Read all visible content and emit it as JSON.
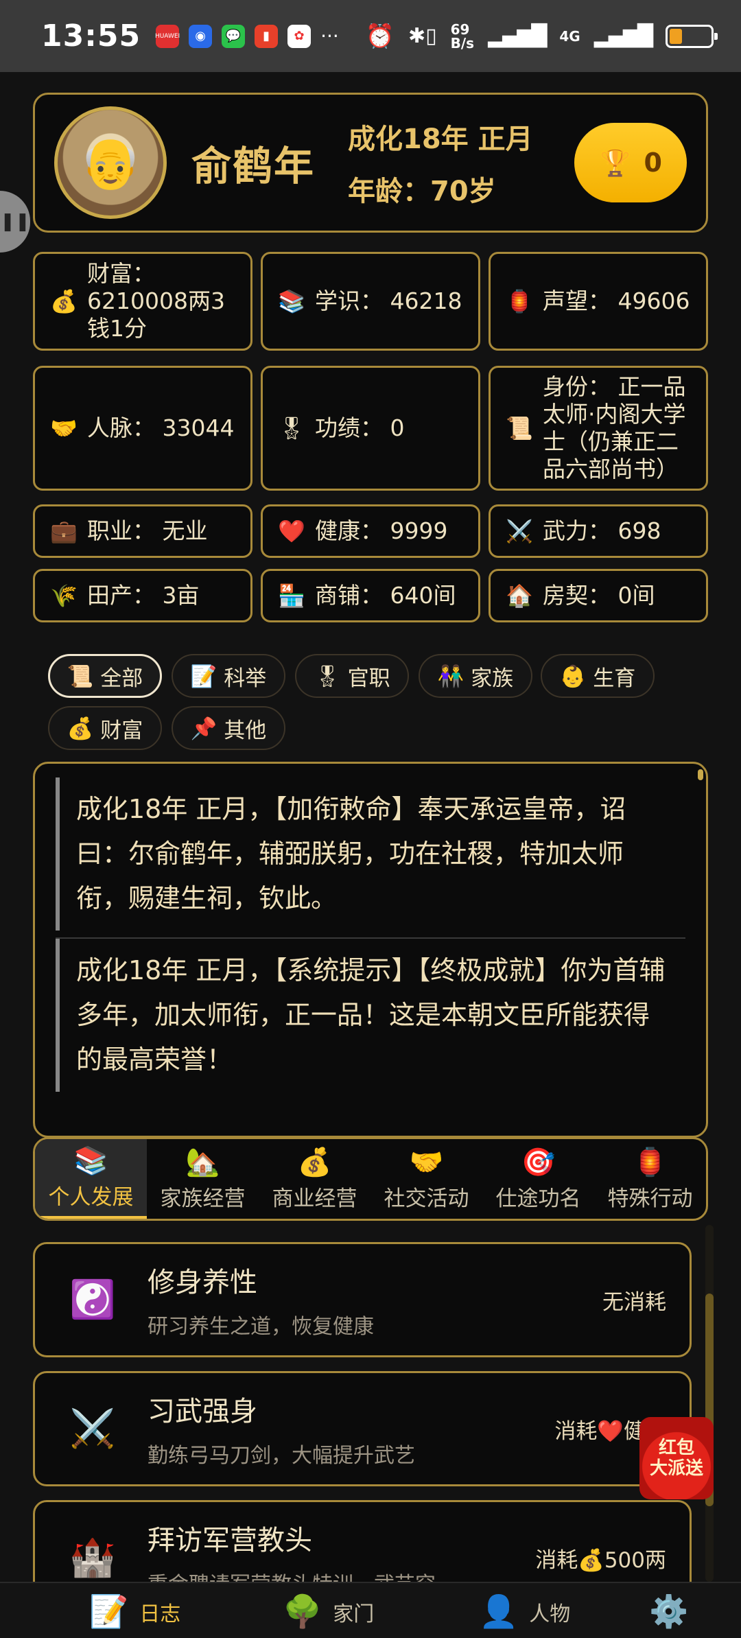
{
  "status_bar": {
    "time": "13:55",
    "notifications": [
      "huawei-app-icon",
      "blue-app-icon",
      "wechat-icon",
      "red-app-icon",
      "multicolor-app-icon"
    ],
    "more": "···",
    "net_speed_top": "69",
    "net_speed_bottom": "B/s",
    "network": "4G"
  },
  "profile": {
    "name": "俞鹤年",
    "date": "成化18年 正月",
    "age": "年龄：70岁",
    "trophy_count": "0"
  },
  "stats": [
    {
      "icon": "💰",
      "label": "财富：  6210008两3钱1分"
    },
    {
      "icon": "📚",
      "label": "学识：  46218"
    },
    {
      "icon": "🏮",
      "label": "声望：  49606"
    },
    {
      "icon": "🤝",
      "label": "人脉：  33044"
    },
    {
      "icon": "🎖",
      "label": "功绩：  0"
    },
    {
      "icon": "📜",
      "label": "身份：  正一品太师·内阁大学士（仍兼正二品六部尚书）"
    },
    {
      "icon": "💼",
      "label": "职业：  无业"
    },
    {
      "icon": "❤️",
      "label": "健康：  9999"
    },
    {
      "icon": "⚔️",
      "label": "武力：  698"
    },
    {
      "icon": "🌾",
      "label": "田产：  3亩"
    },
    {
      "icon": "🏪",
      "label": "商铺：  640间"
    },
    {
      "icon": "🏠",
      "label": "房契：  0间"
    }
  ],
  "filters": [
    {
      "icon": "📜",
      "label": "全部"
    },
    {
      "icon": "📝",
      "label": "科举"
    },
    {
      "icon": "🎖",
      "label": "官职"
    },
    {
      "icon": "👫",
      "label": "家族"
    },
    {
      "icon": "👶",
      "label": "生育"
    },
    {
      "icon": "💰",
      "label": "财富"
    },
    {
      "icon": "📌",
      "label": "其他"
    }
  ],
  "log": [
    {
      "text": "成化18年 正月，【加衔敕命】奉天承运皇帝，诏曰：尔俞鹤年，辅弼朕躬，功在社稷，特加太师衔，赐建生祠，钦此。"
    },
    {
      "text": "成化18年 正月，【系统提示】【终极成就】你为首辅多年，加太师衔，正一品！这是本朝文臣所能获得的最高荣誉！"
    }
  ],
  "category_tabs": [
    {
      "icon": "📚",
      "label": "个人发展"
    },
    {
      "icon": "🏡",
      "label": "家族经营"
    },
    {
      "icon": "💰",
      "label": "商业经营"
    },
    {
      "icon": "🤝",
      "label": "社交活动"
    },
    {
      "icon": "🎯",
      "label": "仕途功名"
    },
    {
      "icon": "🏮",
      "label": "特殊行动"
    }
  ],
  "actions": [
    {
      "icon": "☯️",
      "title": "修身养性",
      "desc": "研习养生之道，恢复健康",
      "cost": "无消耗"
    },
    {
      "icon": "⚔️",
      "title": "习武强身",
      "desc": "勤练弓马刀剑，大幅提升武艺",
      "cost": "消耗❤️健康"
    },
    {
      "icon": "🏰",
      "title": "拜访军营教头",
      "desc": "重金聘请军营教头特训，武艺突…",
      "cost": "消耗💰500两"
    }
  ],
  "redpack": {
    "line1": "红包",
    "line2": "大派送"
  },
  "bottom_nav": [
    {
      "icon": "📝",
      "label": "日志"
    },
    {
      "icon": "🌳",
      "label": "家门"
    },
    {
      "icon": "👤",
      "label": "人物"
    },
    {
      "icon": "⚙️",
      "label": ""
    }
  ],
  "colors": {
    "accent": "#f2c242",
    "border_gold": "#a88a3a",
    "trophy": "#f4b000"
  }
}
